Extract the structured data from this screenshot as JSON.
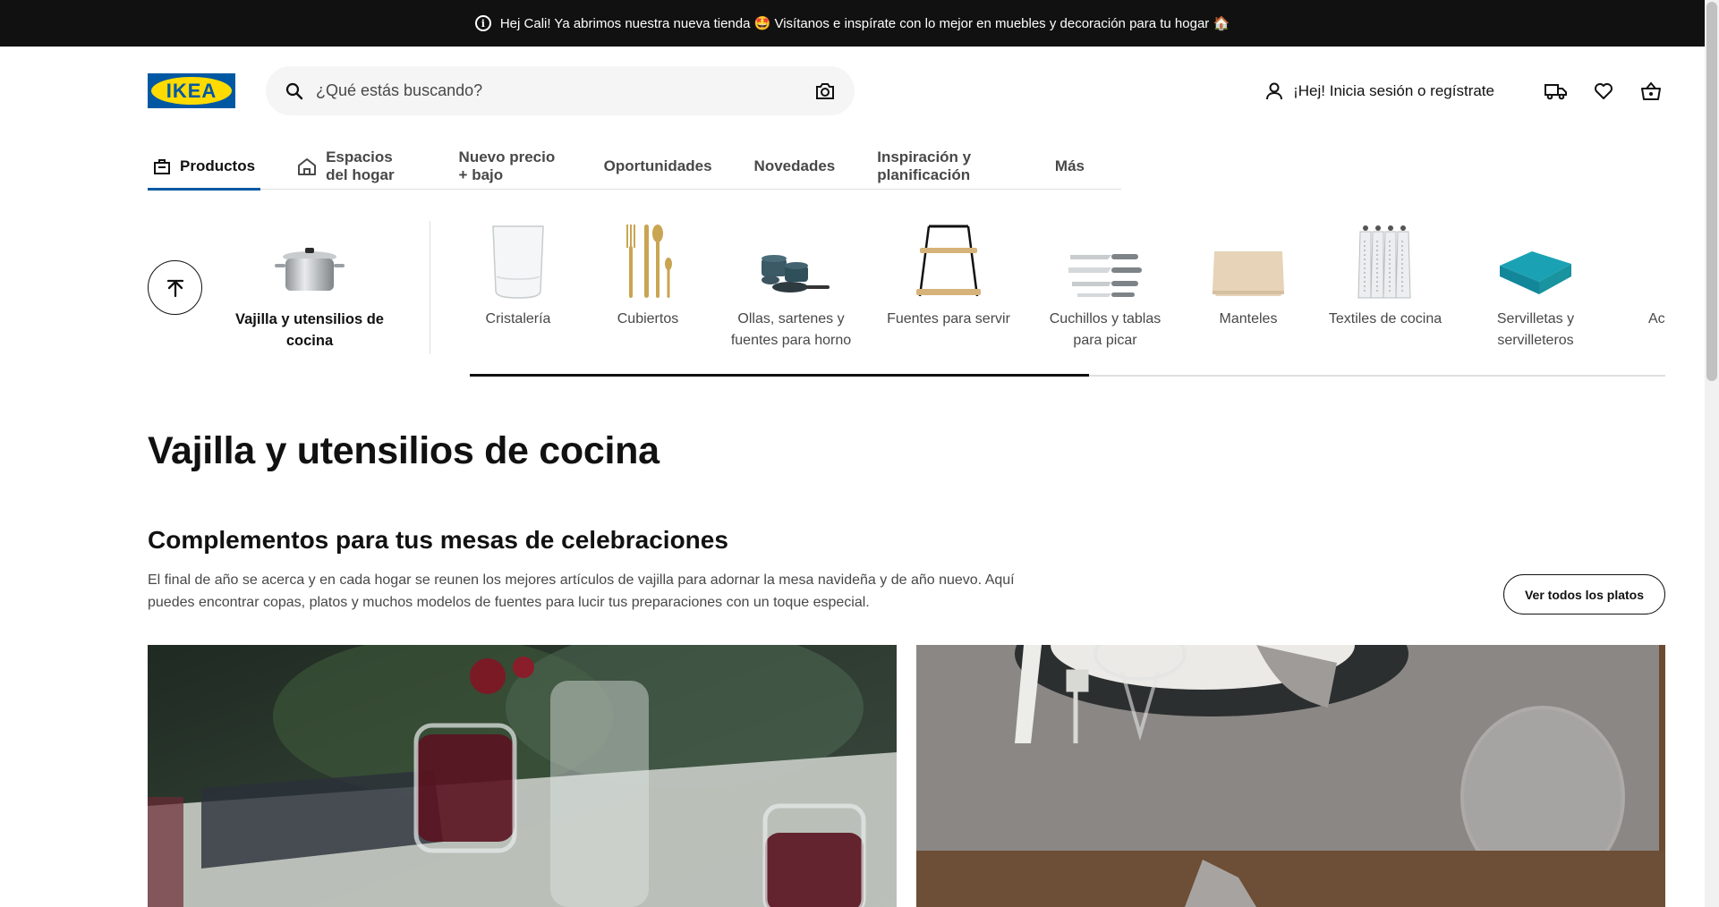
{
  "announcement": {
    "text": "Hej Cali! Ya abrimos nuestra nueva tienda 🤩 Visítanos e inspírate con lo mejor en muebles y decoración para tu hogar 🏠",
    "icon": "info-icon"
  },
  "header": {
    "logo_text": "IKEA",
    "search_placeholder": "¿Qué estás buscando?",
    "login_label": "¡Hej! Inicia sesión o regístrate",
    "icons": [
      "user-icon",
      "truck-icon",
      "heart-icon",
      "basket-icon",
      "camera-icon",
      "search-icon"
    ]
  },
  "nav": {
    "tabs": [
      {
        "label": "Productos",
        "active": true
      },
      {
        "label": "Espacios del hogar"
      },
      {
        "label": "Nuevo precio + bajo"
      },
      {
        "label": "Oportunidades"
      },
      {
        "label": "Novedades"
      },
      {
        "label": "Inspiración y planificación"
      },
      {
        "label": "Más"
      }
    ]
  },
  "categories": {
    "current": "Vajilla y utensilios de cocina",
    "items": [
      "Cristalería",
      "Cubiertos",
      "Ollas, sartenes y fuentes para horno",
      "Fuentes para servir",
      "Cuchillos y tablas para picar",
      "Manteles",
      "Textiles de cocina",
      "Servilletas y servilleteros",
      "Ac"
    ]
  },
  "page": {
    "title": "Vajilla y utensilios de cocina",
    "section_title": "Complementos para tus mesas de celebraciones",
    "section_desc": "El final de año se acerca y en cada hogar se reunen los mejores artículos de vajilla para adornar la mesa navideña y de año nuevo. Aquí puedes encontrar copas, platos y muchos modelos de fuentes para lucir tus preparaciones con un toque especial.",
    "see_all_label": "Ver todos los platos"
  },
  "colors": {
    "brand_blue": "#0058a3",
    "brand_yellow": "#ffdb00",
    "teal_napkin": "#1aa2b4"
  }
}
